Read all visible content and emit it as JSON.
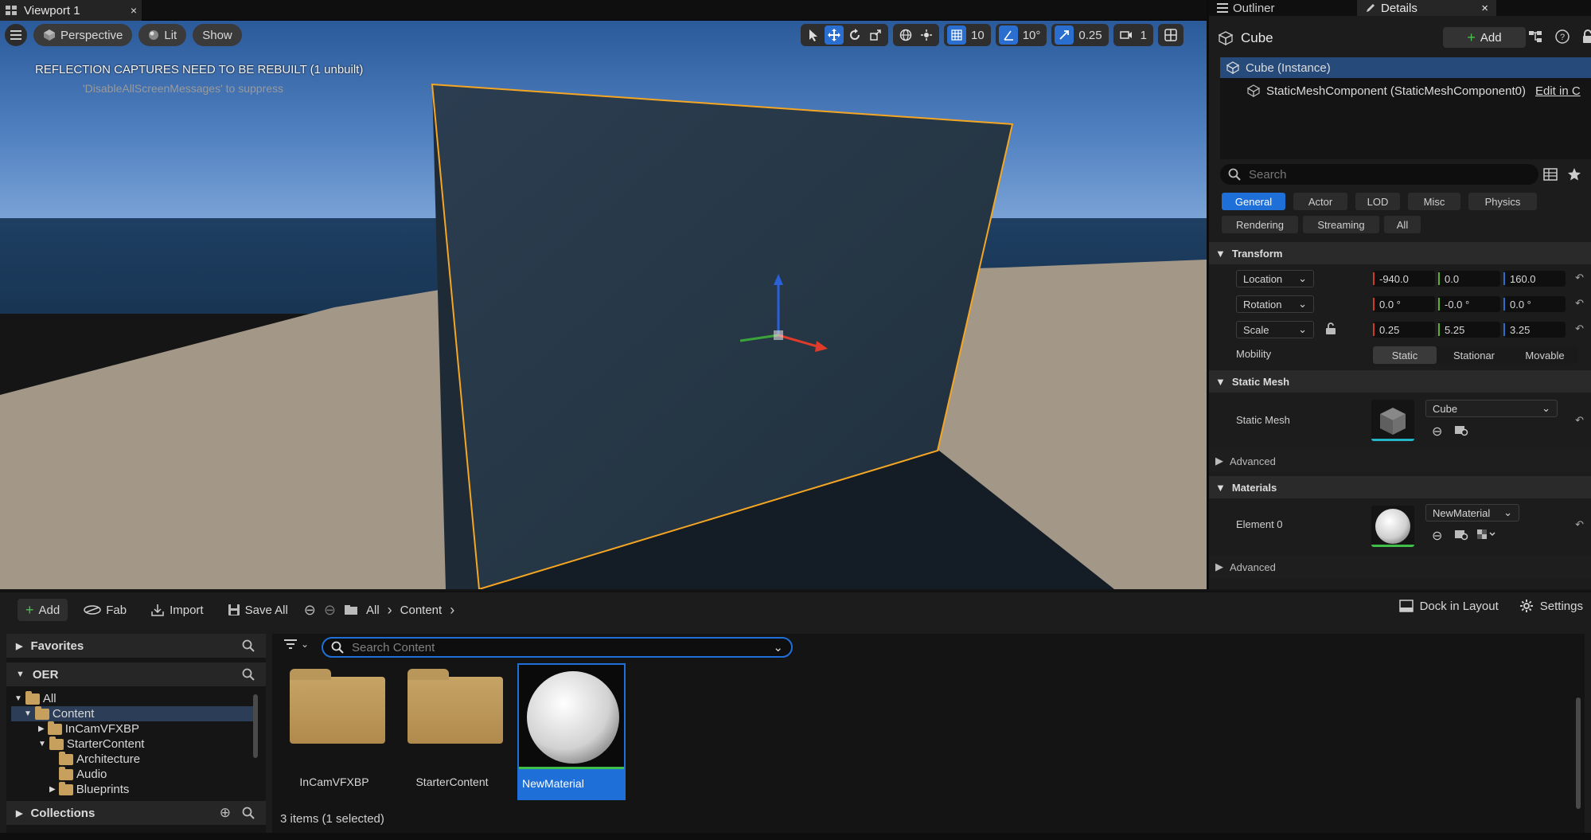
{
  "viewport": {
    "tab_title": "Viewport 1",
    "close": "×",
    "toolbar": {
      "perspective": "Perspective",
      "lit": "Lit",
      "show": "Show",
      "grid_snap": "10",
      "rot_snap": "10°",
      "scale_snap": "0.25",
      "camera_speed": "1"
    },
    "warning": "REFLECTION CAPTURES NEED TO BE REBUILT (1 unbuilt)",
    "suppress_hint": "'DisableAllScreenMessages' to suppress"
  },
  "right_panel": {
    "tabs": {
      "outliner": "Outliner",
      "details": "Details",
      "close": "×"
    },
    "actor_name": "Cube",
    "add_label": "Add",
    "components": {
      "root": "Cube (Instance)",
      "child": "StaticMeshComponent (StaticMeshComponent0)",
      "edit_link": "Edit in C"
    },
    "search_placeholder": "Search",
    "filter_tabs": [
      "General",
      "Actor",
      "LOD",
      "Misc",
      "Physics",
      "Rendering",
      "Streaming",
      "All"
    ],
    "transform": {
      "section": "Transform",
      "location": {
        "label": "Location",
        "x": "-940.0",
        "y": "0.0",
        "z": "160.0"
      },
      "rotation": {
        "label": "Rotation",
        "x": "0.0 °",
        "y": "-0.0 °",
        "z": "0.0 °"
      },
      "scale": {
        "label": "Scale",
        "x": "0.25",
        "y": "5.25",
        "z": "3.25"
      },
      "mobility": {
        "label": "Mobility",
        "options": [
          "Static",
          "Stationar",
          "Movable"
        ]
      }
    },
    "static_mesh": {
      "section": "Static Mesh",
      "label": "Static Mesh",
      "value": "Cube",
      "advanced": "Advanced"
    },
    "materials": {
      "section": "Materials",
      "label": "Element 0",
      "value": "NewMaterial",
      "advanced": "Advanced"
    }
  },
  "content_browser": {
    "toolbar": {
      "add": "Add",
      "fab": "Fab",
      "import": "Import",
      "save_all": "Save All",
      "path_all": "All",
      "path_content": "Content",
      "dock": "Dock in Layout",
      "settings": "Settings"
    },
    "favorites": "Favorites",
    "project": "OER",
    "tree": [
      "All",
      "Content",
      "InCamVFXBP",
      "StarterContent",
      "Architecture",
      "Audio",
      "Blueprints"
    ],
    "collections": "Collections",
    "search_placeholder": "Search Content",
    "items": [
      {
        "name": "InCamVFXBP",
        "type": "folder"
      },
      {
        "name": "StarterContent",
        "type": "folder"
      },
      {
        "name": "NewMaterial",
        "type": "material"
      }
    ],
    "status": "3 items (1 selected)"
  },
  "colors": {
    "accent": "#1f6fd8",
    "selection_outline": "#f5a623",
    "folder": "#c8a05d"
  }
}
